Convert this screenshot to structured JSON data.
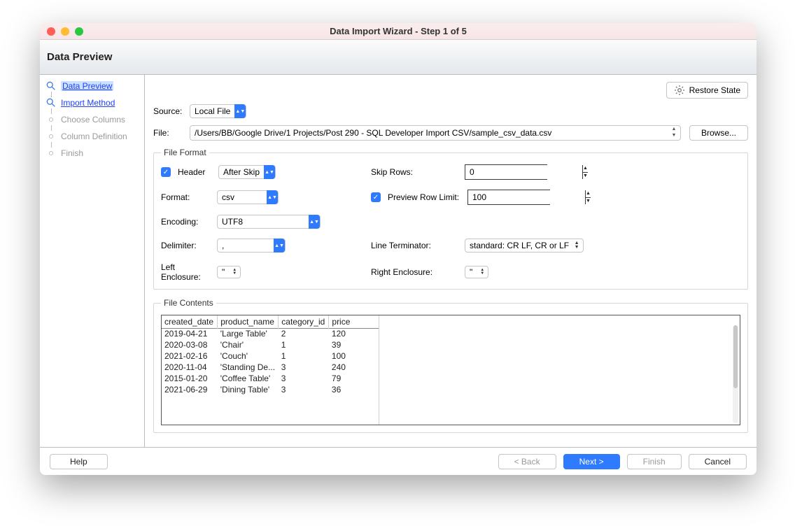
{
  "window": {
    "title": "Data Import Wizard - Step 1 of 5"
  },
  "header": {
    "title": "Data Preview"
  },
  "sidebar": {
    "steps": [
      {
        "label": "Data Preview",
        "state": "current"
      },
      {
        "label": "Import Method",
        "state": "done"
      },
      {
        "label": "Choose Columns",
        "state": "disabled"
      },
      {
        "label": "Column Definition",
        "state": "disabled"
      },
      {
        "label": "Finish",
        "state": "disabled"
      }
    ]
  },
  "restore_state_label": "Restore State",
  "source": {
    "label": "Source:",
    "value": "Local File"
  },
  "file": {
    "label": "File:",
    "value": "/Users/BB/Google Drive/1 Projects/Post 290 - SQL Developer Import CSV/sample_csv_data.csv",
    "browse_label": "Browse..."
  },
  "file_format": {
    "legend": "File Format",
    "header_label": "Header",
    "header_checked": true,
    "header_mode": "After Skip",
    "format_label": "Format:",
    "format_value": "csv",
    "encoding_label": "Encoding:",
    "encoding_value": "UTF8",
    "delimiter_label": "Delimiter:",
    "delimiter_value": ",",
    "left_enclosure_label": "Left Enclosure:",
    "left_enclosure_value": "\"",
    "skip_rows_label": "Skip Rows:",
    "skip_rows_value": "0",
    "preview_limit_checked": true,
    "preview_limit_label": "Preview Row Limit:",
    "preview_limit_value": "100",
    "line_terminator_label": "Line Terminator:",
    "line_terminator_value": "standard: CR LF, CR or LF",
    "right_enclosure_label": "Right Enclosure:",
    "right_enclosure_value": "\""
  },
  "file_contents": {
    "legend": "File Contents",
    "columns": [
      "created_date",
      "product_name",
      "category_id",
      "price"
    ],
    "rows": [
      [
        "2019-04-21",
        "'Large Table'",
        "2",
        "120"
      ],
      [
        "2020-03-08",
        "'Chair'",
        "1",
        "39"
      ],
      [
        "2021-02-16",
        "'Couch'",
        "1",
        "100"
      ],
      [
        "2020-11-04",
        "'Standing De...",
        "3",
        "240"
      ],
      [
        "2015-01-20",
        "'Coffee Table'",
        "3",
        "79"
      ],
      [
        "2021-06-29",
        "'Dining Table'",
        "3",
        "36"
      ]
    ]
  },
  "footer": {
    "help": "Help",
    "back": "< Back",
    "next": "Next >",
    "finish": "Finish",
    "cancel": "Cancel"
  }
}
